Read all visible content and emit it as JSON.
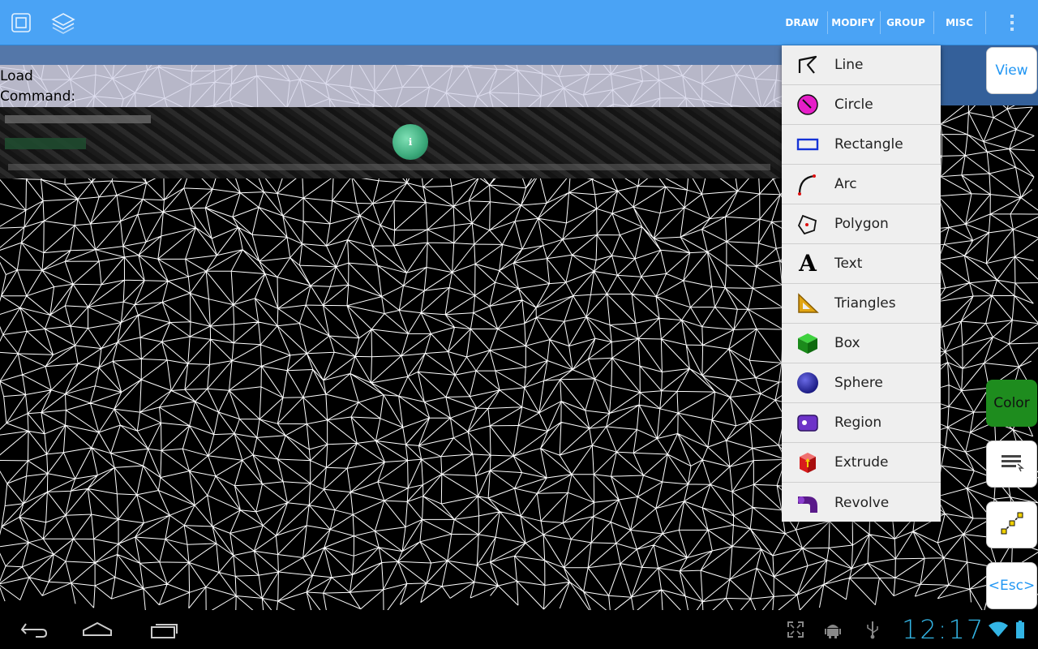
{
  "action_bar": {
    "bg_color": "#4aa3f5",
    "left_icons": [
      "window-icon",
      "layers-icon"
    ],
    "menus": [
      "DRAW",
      "MODIFY",
      "GROUP",
      "MISC"
    ],
    "overflow_icon": "overflow-menu-icon"
  },
  "command_area": {
    "line1": "Load",
    "line2": "Command:"
  },
  "draw_menu": {
    "items": [
      {
        "label": "Line",
        "icon": "line-icon"
      },
      {
        "label": "Circle",
        "icon": "circle-icon"
      },
      {
        "label": "Rectangle",
        "icon": "rectangle-icon"
      },
      {
        "label": "Arc",
        "icon": "arc-icon"
      },
      {
        "label": "Polygon",
        "icon": "polygon-icon"
      },
      {
        "label": "Text",
        "icon": "text-icon"
      },
      {
        "label": "Triangles",
        "icon": "triangles-icon"
      },
      {
        "label": "Box",
        "icon": "box-icon"
      },
      {
        "label": "Sphere",
        "icon": "sphere-icon"
      },
      {
        "label": "Region",
        "icon": "region-icon"
      },
      {
        "label": "Extrude",
        "icon": "extrude-icon"
      },
      {
        "label": "Revolve",
        "icon": "revolve-icon"
      }
    ]
  },
  "side_buttons": {
    "view": "View",
    "color": "Color",
    "color_bg": "#1e8c1e",
    "esc": "<Esc>",
    "list_icon": "command-list-icon",
    "snap_icon": "snap-line-icon"
  },
  "system_bar": {
    "back_icon": "back-icon",
    "home_icon": "home-icon",
    "recents_icon": "recents-icon",
    "fullscreen_icon": "fullscreen-icon",
    "android_icon": "android-debug-icon",
    "usb_icon": "usb-icon",
    "clock": "12:17",
    "wifi_icon": "wifi-icon",
    "battery_icon": "battery-icon"
  }
}
